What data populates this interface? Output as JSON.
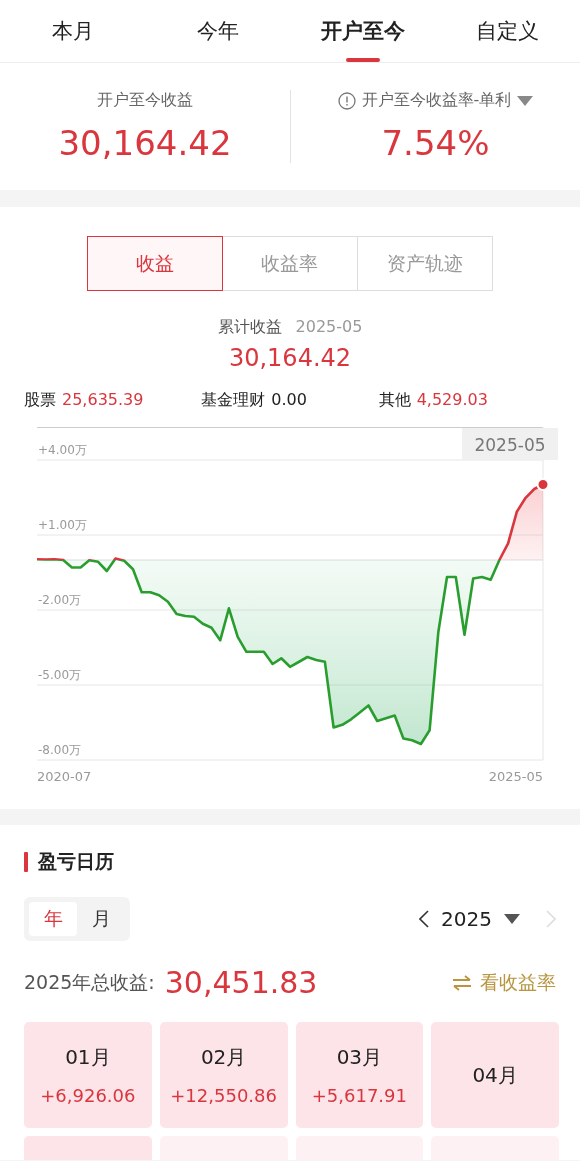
{
  "period_tabs": [
    {
      "label": "本月",
      "selected": false
    },
    {
      "label": "今年",
      "selected": false
    },
    {
      "label": "开户至今",
      "selected": true
    },
    {
      "label": "自定义",
      "selected": false
    }
  ],
  "summary": {
    "profit_label": "开户至今收益",
    "profit_value": "30,164.42",
    "rate_label": "开户至今收益率-单利",
    "rate_value": "7.54%"
  },
  "view_tabs": [
    {
      "label": "收益",
      "selected": true
    },
    {
      "label": "收益率",
      "selected": false
    },
    {
      "label": "资产轨迹",
      "selected": false
    }
  ],
  "cumulative": {
    "label": "累计收益",
    "date": "2025-05",
    "value": "30,164.42"
  },
  "breakdown": [
    {
      "label": "股票",
      "value": "25,635.39",
      "positive": true
    },
    {
      "label": "基金理财",
      "value": "0.00",
      "positive": false
    },
    {
      "label": "其他",
      "value": "4,529.03",
      "positive": true
    }
  ],
  "chart": {
    "tooltip": "2025-05",
    "x_start": "2020-07",
    "x_end": "2025-05",
    "chart_data": {
      "type": "area",
      "grid": true,
      "ylim": [
        -8,
        4
      ],
      "yticks": [
        {
          "value": 4,
          "label": "+4.00万"
        },
        {
          "value": 1,
          "label": "+1.00万"
        },
        {
          "value": -2,
          "label": "-2.00万"
        },
        {
          "value": -5,
          "label": "-5.00万"
        },
        {
          "value": -8,
          "label": "-8.00万"
        }
      ],
      "series": [
        {
          "color": "#2a9d2f",
          "values": [
            0.03,
            0.02,
            0.03,
            0,
            -0.3,
            -0.3,
            -0.01,
            -0.07,
            -0.44,
            0.06,
            -0.03,
            -0.37,
            -1.29,
            -1.29,
            -1.41,
            -1.67,
            -2.16,
            -2.24,
            -2.27,
            -2.55,
            -2.71,
            -3.21,
            -1.93,
            -3.07,
            -3.67,
            -3.67,
            -3.67,
            -4.16,
            -3.93,
            -4.27,
            -4.08,
            -3.88,
            -4.0,
            -4.07,
            -6.7,
            -6.59,
            -6.37,
            -6.1,
            -5.82,
            -6.44,
            -6.33,
            -6.22,
            -7.14,
            -7.21,
            -7.36,
            -6.81,
            -2.89,
            -0.68,
            -0.68,
            -2.99,
            -0.74,
            -0.68,
            -0.79,
            0,
            0.67,
            1.93,
            2.49,
            2.84,
            3.02
          ]
        }
      ]
    }
  },
  "calendar": {
    "title": "盈亏日历",
    "modes": [
      {
        "label": "年",
        "selected": true
      },
      {
        "label": "月",
        "selected": false
      }
    ],
    "year": "2025",
    "total_label": "2025年总收益:",
    "total_value": "30,451.83",
    "switch_label": "看收益率",
    "months": [
      {
        "month": "01月",
        "value": "+6,926.06"
      },
      {
        "month": "02月",
        "value": "+12,550.86"
      },
      {
        "month": "03月",
        "value": "+5,617.91"
      },
      {
        "month": "04月"
      }
    ]
  }
}
